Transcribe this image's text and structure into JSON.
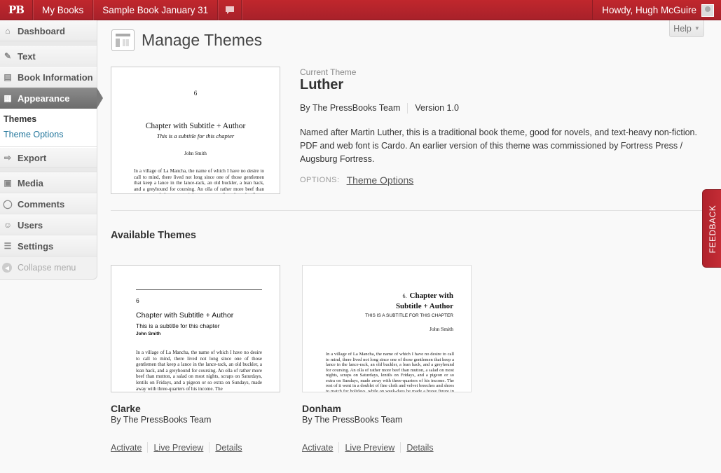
{
  "adminbar": {
    "logo": "PB",
    "my_books": "My Books",
    "book_title": "Sample Book January 31",
    "howdy": "Howdy, Hugh McGuire"
  },
  "menu": {
    "items": [
      {
        "label": "Dashboard",
        "icon": "dashboard-icon"
      },
      {
        "label": "Text",
        "icon": "pin-icon"
      },
      {
        "label": "Book Information",
        "icon": "book-icon"
      },
      {
        "label": "Appearance",
        "icon": "appearance-icon"
      },
      {
        "label": "Export",
        "icon": "export-icon"
      },
      {
        "label": "Media",
        "icon": "media-icon"
      },
      {
        "label": "Comments",
        "icon": "comments-icon"
      },
      {
        "label": "Users",
        "icon": "users-icon"
      },
      {
        "label": "Settings",
        "icon": "settings-icon"
      }
    ],
    "submenu": [
      "Themes",
      "Theme Options"
    ],
    "collapse": "Collapse menu"
  },
  "help": "Help",
  "page_title": "Manage Themes",
  "current_theme": {
    "label": "Current Theme",
    "name": "Luther",
    "author": "By The PressBooks Team",
    "version": "Version 1.0",
    "description": "Named after Martin Luther, this is a traditional book theme, good for novels, and text-heavy non-fiction. PDF and web font is Cardo. An earlier version of this theme was commissioned by Fortress Press / Augsburg Fortress.",
    "options_label": "OPTIONS:",
    "options_link": "Theme Options",
    "preview": {
      "page_number": "6",
      "chapter_title": "Chapter with Subtitle + Author",
      "subtitle": "This is a subtitle for this chapter",
      "author": "John Smith",
      "body": "In a village of La Mancha, the name of which I have no desire to call to mind, there lived not long since one of those gentlemen that keep a lance in the lance-rack, an old buckler, a lean hack, and a greyhound for coursing. An olla of rather more beef than mutton, a salad on most nights, scraps on Saturdays, lentils on Fridays."
    }
  },
  "available_title": "Available Themes",
  "themes": [
    {
      "name": "Clarke",
      "author": "By The PressBooks Team",
      "actions": [
        "Activate",
        "Live Preview",
        "Details"
      ],
      "preview": {
        "page_number": "6",
        "chapter_title": "Chapter with Subtitle + Author",
        "subtitle": "This is a subtitle for this chapter",
        "author": "John Smith",
        "body": "In a village of La Mancha, the name of which I have no desire to call to mind, there lived not long since one of those gentlemen that keep a lance in the lance-rack, an old buckler, a lean hack, and a greyhound for coursing. An olla of rather more beef than mutton, a salad on most nights, scraps on Saturdays, lentils on Fridays, and a pigeon or so extra on Sundays, made away with three-quarters of his income. The"
      }
    },
    {
      "name": "Donham",
      "author": "By The PressBooks Team",
      "actions": [
        "Activate",
        "Live Preview",
        "Details"
      ],
      "preview": {
        "page_number": "6.",
        "chapter_title_1": "Chapter with",
        "chapter_title_2": "Subtitle + Author",
        "subtitle": "THIS IS A SUBTITLE FOR THIS CHAPTER",
        "author": "John Smith",
        "body": "In a village of La Mancha, the name of which I have no desire to call to mind, there lived not long since one of those gentlemen that keep a lance in the lance-rack, an old buckler, a lean hack, and a greyhound for coursing. An olla of rather more beef than mutton, a salad on most nights, scraps on Saturdays, lentils on Fridays, and a pigeon or so extra on Sundays, made away with three-quarters of his income. The rest of it went in a doublet of fine cloth and velvet breeches and shoes to match for holidays, while on week-days he made a brave figure in his best homespun. He had in his"
      }
    }
  ],
  "feedback": "FEEDBACK",
  "colors": {
    "brand": "#b0222c",
    "link": "#555555"
  }
}
